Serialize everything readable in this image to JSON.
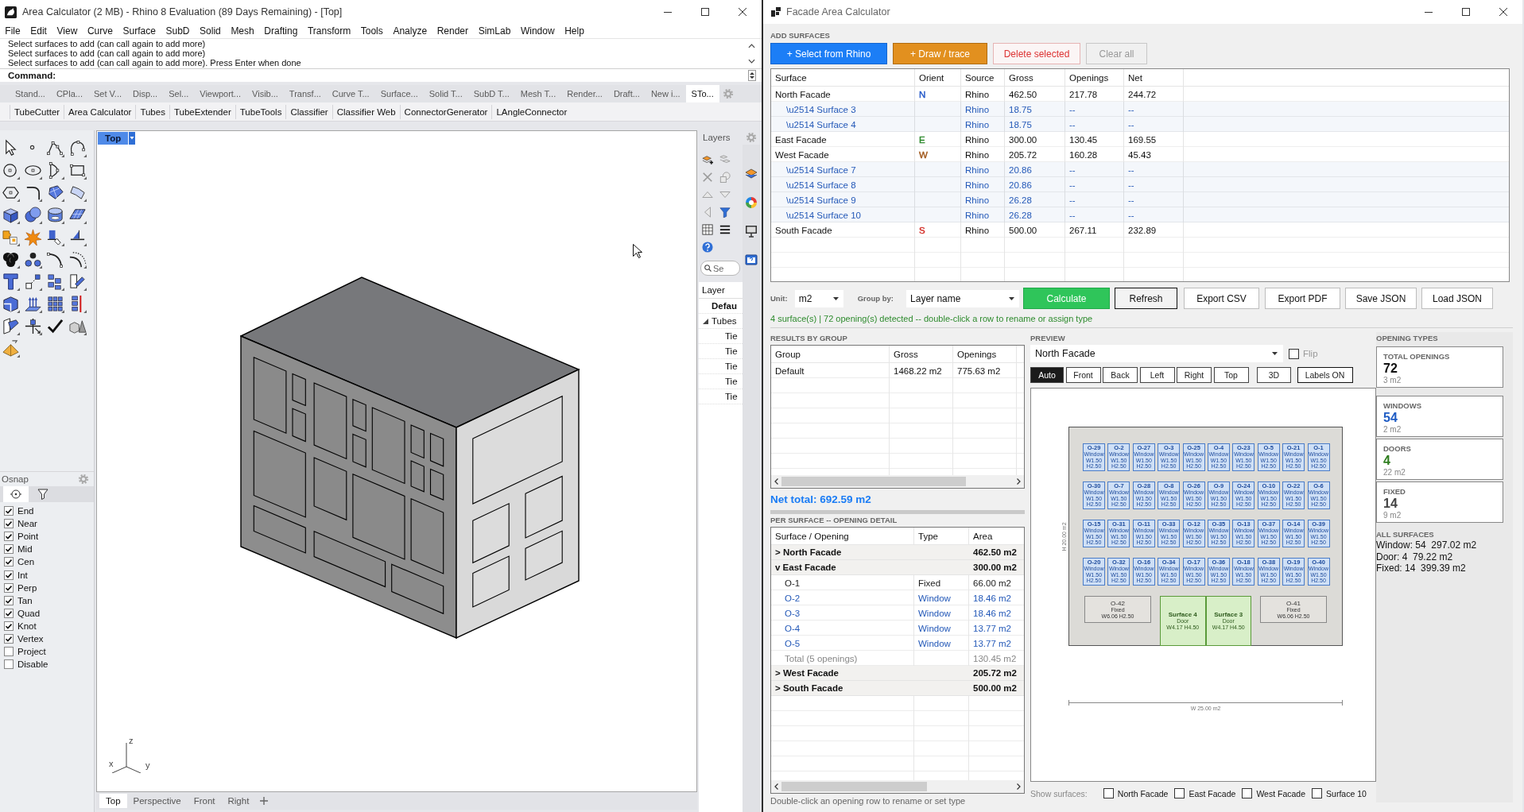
{
  "rhino": {
    "title": "Area Calculator (2 MB) - Rhino 8 Evaluation (89 Days Remaining) - [Top]",
    "menu": [
      "File",
      "Edit",
      "View",
      "Curve",
      "Surface",
      "SubD",
      "Solid",
      "Mesh",
      "Drafting",
      "Transform",
      "Tools",
      "Analyze",
      "Render",
      "SimLab",
      "Window",
      "Help"
    ],
    "command_history": [
      "Select surfaces to add (can call again to add more)",
      "Select surfaces to add (can call again to add more)",
      "Select surfaces to add (can call again to add more). Press Enter when done"
    ],
    "command_prompt": "Command:",
    "toolbar_tabs": [
      {
        "label": "Stand...",
        "selected": false
      },
      {
        "label": "CPla...",
        "selected": false
      },
      {
        "label": "Set V...",
        "selected": false
      },
      {
        "label": "Disp...",
        "selected": false
      },
      {
        "label": "Sel...",
        "selected": false
      },
      {
        "label": "Viewport...",
        "selected": false
      },
      {
        "label": "Visib...",
        "selected": false
      },
      {
        "label": "Transf...",
        "selected": false
      },
      {
        "label": "Curve T...",
        "selected": false
      },
      {
        "label": "Surface...",
        "selected": false
      },
      {
        "label": "Solid T...",
        "selected": false
      },
      {
        "label": "SubD T...",
        "selected": false
      },
      {
        "label": "Mesh T...",
        "selected": false
      },
      {
        "label": "Render...",
        "selected": false
      },
      {
        "label": "Draft...",
        "selected": false
      },
      {
        "label": "New i...",
        "selected": false
      },
      {
        "label": "STo...",
        "selected": true
      }
    ],
    "toolbar_buttons": [
      "TubeCutter",
      "Area Calculator",
      "Tubes",
      "TubeExtender",
      "TubeTools",
      "Classifier",
      "Classifier Web",
      "ConnectorGenerator",
      "LAngleConnector"
    ],
    "viewport": {
      "title": "Top",
      "axis_labels": [
        "z",
        "x",
        "y"
      ],
      "tabs": [
        {
          "label": "Top",
          "selected": true
        },
        {
          "label": "Perspective",
          "selected": false
        },
        {
          "label": "Front",
          "selected": false
        },
        {
          "label": "Right",
          "selected": false
        }
      ]
    },
    "osnap": {
      "title": "Osnap",
      "items": [
        {
          "label": "End",
          "checked": true
        },
        {
          "label": "Near",
          "checked": true
        },
        {
          "label": "Point",
          "checked": true
        },
        {
          "label": "Mid",
          "checked": true
        },
        {
          "label": "Cen",
          "checked": true
        },
        {
          "label": "Int",
          "checked": true
        },
        {
          "label": "Perp",
          "checked": true
        },
        {
          "label": "Tan",
          "checked": true
        },
        {
          "label": "Quad",
          "checked": true
        },
        {
          "label": "Knot",
          "checked": true
        },
        {
          "label": "Vertex",
          "checked": true
        },
        {
          "label": "Project",
          "checked": false
        },
        {
          "label": "Disable",
          "checked": false
        }
      ]
    },
    "layers": {
      "title": "Layers",
      "search": {
        "placeholder": "Se"
      },
      "column": "Layer",
      "items": [
        {
          "name": "Defau",
          "current": true
        },
        {
          "name": "Tubes",
          "current": false,
          "expanded": true,
          "children": [
            {
              "name": "Tie",
              "current": false
            },
            {
              "name": "Tie",
              "current": false
            },
            {
              "name": "Tie",
              "current": false
            },
            {
              "name": "Tie",
              "current": false
            },
            {
              "name": "Tie",
              "current": false
            }
          ]
        }
      ]
    }
  },
  "app": {
    "title": "Facade Area Calculator",
    "add_surfaces": {
      "heading": "ADD SURFACES",
      "buttons": [
        {
          "label": "+ Select from Rhino",
          "kind": "primary"
        },
        {
          "label": "+ Draw / trace",
          "kind": "accent"
        },
        {
          "label": "Delete selected",
          "kind": "danger"
        },
        {
          "label": "Clear all",
          "kind": "disabled"
        }
      ]
    },
    "surfaces": {
      "columns": [
        "Surface",
        "Orient",
        "Source",
        "Gross",
        "Openings",
        "Net"
      ],
      "rows": [
        {
          "surface": "North Facade",
          "orient": "N",
          "color": "#2459c8",
          "source": "Rhino",
          "gross": "462.50",
          "openings": "217.78",
          "net": "244.72",
          "children": [
            {
              "surface": "\\u2514 Surface 3",
              "source": "Rhino",
              "gross": "18.75",
              "openings": "--",
              "net": "--"
            },
            {
              "surface": "\\u2514 Surface 4",
              "source": "Rhino",
              "gross": "18.75",
              "openings": "--",
              "net": "--"
            }
          ]
        },
        {
          "surface": "East Facade",
          "orient": "E",
          "color": "#2e8b2e",
          "source": "Rhino",
          "gross": "300.00",
          "openings": "130.45",
          "net": "169.55"
        },
        {
          "surface": "West Facade",
          "orient": "W",
          "color": "#a0581c",
          "source": "Rhino",
          "gross": "205.72",
          "openings": "160.28",
          "net": "45.43",
          "children": [
            {
              "surface": "\\u2514 Surface 7",
              "source": "Rhino",
              "gross": "20.86",
              "openings": "--",
              "net": "--"
            },
            {
              "surface": "\\u2514 Surface 8",
              "source": "Rhino",
              "gross": "20.86",
              "openings": "--",
              "net": "--"
            },
            {
              "surface": "\\u2514 Surface 9",
              "source": "Rhino",
              "gross": "26.28",
              "openings": "--",
              "net": "--"
            },
            {
              "surface": "\\u2514 Surface 10",
              "source": "Rhino",
              "gross": "26.28",
              "openings": "--",
              "net": "--"
            }
          ]
        },
        {
          "surface": "South Facade",
          "orient": "S",
          "color": "#d4302a",
          "source": "Rhino",
          "gross": "500.00",
          "openings": "267.11",
          "net": "232.89"
        }
      ]
    },
    "controls": {
      "unit_label": "Unit:",
      "unit": "m2",
      "group_label": "Group by:",
      "group": "Layer name",
      "buttons": [
        {
          "label": "Calculate",
          "kind": "primary"
        },
        {
          "label": "Refresh",
          "kind": "default"
        },
        {
          "label": "Export CSV",
          "kind": "plain"
        },
        {
          "label": "Export PDF",
          "kind": "plain"
        },
        {
          "label": "Save JSON",
          "kind": "plain"
        },
        {
          "label": "Load JSON",
          "kind": "plain"
        }
      ]
    },
    "status": "4 surface(s) | 72 opening(s) detected -- double-click a row to rename or assign type",
    "results": {
      "heading": "RESULTS BY GROUP",
      "columns": [
        "Group",
        "Gross",
        "Openings"
      ],
      "rows": [
        {
          "group": "Default",
          "gross": "1468.22 m2",
          "openings": "775.63 m2"
        }
      ]
    },
    "net_total": "Net total: 692.59 m2",
    "detail": {
      "heading": "PER SURFACE -- OPENING DETAIL",
      "columns": [
        "Surface / Opening",
        "Type",
        "Area"
      ],
      "rows": [
        {
          "label": "> North Facade",
          "area": "462.50 m2"
        },
        {
          "label": "v East Facade",
          "area": "300.00 m2",
          "children": [
            {
              "kind": "fixed",
              "label": "O-1",
              "type": "Fixed",
              "area": "66.00 m2"
            },
            {
              "kind": "window",
              "label": "O-2",
              "type": "Window",
              "area": "18.46 m2"
            },
            {
              "kind": "window",
              "label": "O-3",
              "type": "Window",
              "area": "18.46 m2"
            },
            {
              "kind": "window",
              "label": "O-4",
              "type": "Window",
              "area": "13.77 m2"
            },
            {
              "kind": "window",
              "label": "O-5",
              "type": "Window",
              "area": "13.77 m2"
            },
            {
              "kind": "total",
              "label": "Total (5 openings)",
              "area": "130.45 m2"
            }
          ]
        },
        {
          "label": "> West Facade",
          "area": "205.72 m2"
        },
        {
          "label": "> South Facade",
          "area": "500.00 m2"
        }
      ],
      "hint": "Double-click an opening row to rename or set type"
    },
    "preview": {
      "heading": "PREVIEW",
      "surface": "North Facade",
      "flip": {
        "label": "Flip",
        "checked": false
      },
      "views": [
        {
          "label": "Auto",
          "selected": true
        },
        {
          "label": "Front",
          "selected": false
        },
        {
          "label": "Back",
          "selected": false
        },
        {
          "label": "Left",
          "selected": false
        },
        {
          "label": "Right",
          "selected": false
        },
        {
          "label": "Top",
          "selected": false
        }
      ],
      "tools": [
        "3D",
        "Labels ON"
      ],
      "height_label": "H 20.00 m2",
      "width_label": "W 25.00 m2",
      "window_rows": [
        [
          {
            "kind": "window",
            "label": "O-29",
            "type": "Window",
            "size": "W1.50 H2.50"
          },
          {
            "kind": "window",
            "label": "O-2",
            "type": "Window",
            "size": "W1.50 H2.50"
          },
          {
            "kind": "window",
            "label": "O-27",
            "type": "Window",
            "size": "W1.50 H2.50"
          },
          {
            "kind": "window",
            "label": "O-3",
            "type": "Window",
            "size": "W1.50 H2.50"
          },
          {
            "kind": "window",
            "label": "O-25",
            "type": "Window",
            "size": "W1.50 H2.50"
          },
          {
            "kind": "window",
            "label": "O-4",
            "type": "Window",
            "size": "W1.50 H2.50"
          },
          {
            "kind": "window",
            "label": "O-23",
            "type": "Window",
            "size": "W1.50 H2.50"
          },
          {
            "kind": "window",
            "label": "O-5",
            "type": "Window",
            "size": "W1.50 H2.50"
          },
          {
            "kind": "window",
            "label": "O-21",
            "type": "Window",
            "size": "W1.50 H2.50"
          },
          {
            "kind": "window",
            "label": "O-1",
            "type": "Window",
            "size": "W1.50 H2.50"
          }
        ],
        [
          {
            "kind": "window",
            "label": "O-30",
            "type": "Window",
            "size": "W1.50 H2.50"
          },
          {
            "kind": "window",
            "label": "O-7",
            "type": "Window",
            "size": "W1.50 H2.50"
          },
          {
            "kind": "window",
            "label": "O-28",
            "type": "Window",
            "size": "W1.50 H2.50"
          },
          {
            "kind": "window",
            "label": "O-8",
            "type": "Window",
            "size": "W1.50 H2.50"
          },
          {
            "kind": "window",
            "label": "O-26",
            "type": "Window",
            "size": "W1.50 H2.50"
          },
          {
            "kind": "window",
            "label": "O-9",
            "type": "Window",
            "size": "W1.50 H2.50"
          },
          {
            "kind": "window",
            "label": "O-24",
            "type": "Window",
            "size": "W1.50 H2.50"
          },
          {
            "kind": "window",
            "label": "O-10",
            "type": "Window",
            "size": "W1.50 H2.50"
          },
          {
            "kind": "window",
            "label": "O-22",
            "type": "Window",
            "size": "W1.50 H2.50"
          },
          {
            "kind": "window",
            "label": "O-6",
            "type": "Window",
            "size": "W1.50 H2.50"
          }
        ],
        [
          {
            "kind": "window",
            "label": "O-15",
            "type": "Window",
            "size": "W1.50 H2.50"
          },
          {
            "kind": "window",
            "label": "O-31",
            "type": "Window",
            "size": "W1.50 H2.50"
          },
          {
            "kind": "window",
            "label": "O-11",
            "type": "Window",
            "size": "W1.50 H2.50"
          },
          {
            "kind": "window",
            "label": "O-33",
            "type": "Window",
            "size": "W1.50 H2.50"
          },
          {
            "kind": "window",
            "label": "O-12",
            "type": "Window",
            "size": "W1.50 H2.50"
          },
          {
            "kind": "window",
            "label": "O-35",
            "type": "Window",
            "size": "W1.50 H2.50"
          },
          {
            "kind": "window",
            "label": "O-13",
            "type": "Window",
            "size": "W1.50 H2.50"
          },
          {
            "kind": "window",
            "label": "O-37",
            "type": "Window",
            "size": "W1.50 H2.50"
          },
          {
            "kind": "window",
            "label": "O-14",
            "type": "Window",
            "size": "W1.50 H2.50"
          },
          {
            "kind": "window",
            "label": "O-39",
            "type": "Window",
            "size": "W1.50 H2.50"
          }
        ],
        [
          {
            "kind": "window",
            "label": "O-20",
            "type": "Window",
            "size": "W1.50 H2.50"
          },
          {
            "kind": "window",
            "label": "O-32",
            "type": "Window",
            "size": "W1.50 H2.50"
          },
          {
            "kind": "window",
            "label": "O-16",
            "type": "Window",
            "size": "W1.50 H2.50"
          },
          {
            "kind": "window",
            "label": "O-34",
            "type": "Window",
            "size": "W1.50 H2.50"
          },
          {
            "kind": "window",
            "label": "O-17",
            "type": "Window",
            "size": "W1.50 H2.50"
          },
          {
            "kind": "window",
            "label": "O-36",
            "type": "Window",
            "size": "W1.50 H2.50"
          },
          {
            "kind": "window",
            "label": "O-18",
            "type": "Window",
            "size": "W1.50 H2.50"
          },
          {
            "kind": "window",
            "label": "O-38",
            "type": "Window",
            "size": "W1.50 H2.50"
          },
          {
            "kind": "window",
            "label": "O-19",
            "type": "Window",
            "size": "W1.50 H2.50"
          },
          {
            "kind": "window",
            "label": "O-40",
            "type": "Window",
            "size": "W1.50 H2.50"
          }
        ]
      ],
      "bottom_openings": [
        {
          "kind": "fixed",
          "label": "O-42",
          "type": "Fixed",
          "size": "W6.06 H2.50"
        },
        {
          "kind": "door",
          "label": "Surface 4",
          "type": "Door",
          "size": "W4.17 H4.50"
        },
        {
          "kind": "door",
          "label": "Surface 3",
          "type": "Door",
          "size": "W4.17 H4.50"
        },
        {
          "kind": "fixed",
          "label": "O-41",
          "type": "Fixed",
          "size": "W6.06 H2.50"
        }
      ],
      "show_surfaces": {
        "label": "Show surfaces:",
        "items": [
          {
            "label": "North Facade",
            "checked": false
          },
          {
            "label": "East Facade",
            "checked": false
          },
          {
            "label": "West Facade",
            "checked": false
          },
          {
            "label": "Surface 10",
            "checked": false
          }
        ]
      }
    },
    "opening_types": {
      "heading": "OPENING TYPES",
      "cards": [
        {
          "title": "TOTAL OPENINGS",
          "count": "72",
          "sub": "3 m2",
          "color": "#111111"
        },
        {
          "title": "WINDOWS",
          "count": "54",
          "sub": "2 m2",
          "color": "#1f5cc4"
        },
        {
          "title": "DOORS",
          "count": "4",
          "sub": "22 m2",
          "color": "#2e7d1e"
        },
        {
          "title": "FIXED",
          "count": "14",
          "sub": "9 m2",
          "color": "#444444"
        }
      ],
      "all_heading": "ALL SURFACES",
      "all_lines": [
        "Window: 54  297.02 m2",
        "Door: 4  79.22 m2",
        "Fixed: 14  399.39 m2"
      ]
    }
  }
}
